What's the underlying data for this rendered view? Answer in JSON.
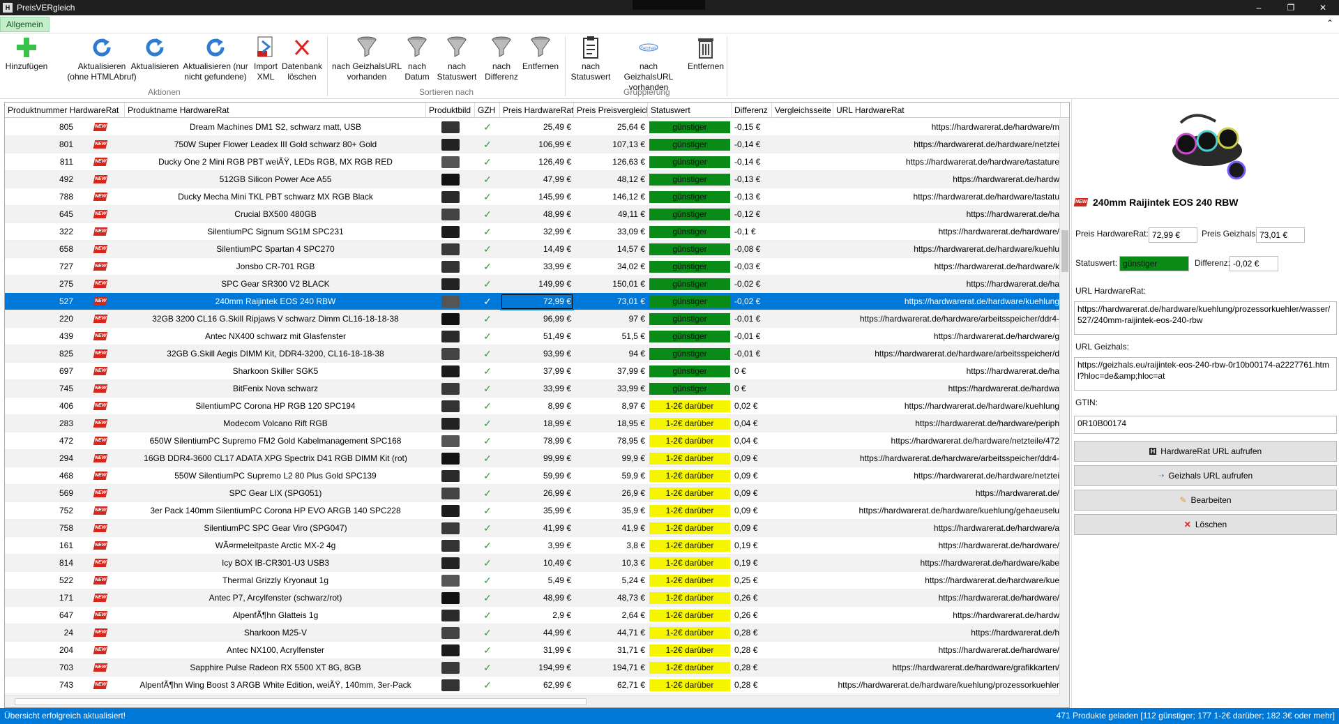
{
  "window": {
    "title": "PreisVERgleich",
    "min": "–",
    "max": "❐",
    "close": "✕"
  },
  "tab": {
    "label": "Allgemein",
    "collapse": "⌃"
  },
  "ribbon": {
    "buttons": [
      {
        "label1": "Hinzufügen",
        "label2": "",
        "icon": "plus-icon"
      },
      {
        "label1": "Aktualisieren",
        "label2": "(ohne HTMLAbruf)",
        "icon": "refresh-icon"
      },
      {
        "label1": "Aktualisieren",
        "label2": "",
        "icon": "refresh-icon"
      },
      {
        "label1": "Aktualisieren (nur",
        "label2": "nicht gefundene)",
        "icon": "refresh-icon"
      },
      {
        "label1": "Import",
        "label2": "XML",
        "icon": "import-icon"
      },
      {
        "label1": "Datenbank",
        "label2": "löschen",
        "icon": "delete-icon"
      },
      {
        "label1": "nach GeizhalsURL",
        "label2": "vorhanden",
        "icon": "filter-icon"
      },
      {
        "label1": "nach",
        "label2": "Datum",
        "icon": "filter-icon"
      },
      {
        "label1": "nach",
        "label2": "Statuswert",
        "icon": "filter-icon"
      },
      {
        "label1": "nach",
        "label2": "Differenz",
        "icon": "filter-icon"
      },
      {
        "label1": "Entfernen",
        "label2": "",
        "icon": "filter-icon"
      },
      {
        "label1": "nach",
        "label2": "Statuswert",
        "icon": "clipboard-icon"
      },
      {
        "label1": "nach GeizhalsURL",
        "label2": "vorhanden",
        "icon": "geizhals-icon"
      },
      {
        "label1": "Entfernen",
        "label2": "",
        "icon": "trash-icon"
      }
    ],
    "groups": [
      "Aktionen",
      "Sortieren nach",
      "Gruppierung"
    ]
  },
  "grid": {
    "columns": [
      "Produktnummer HardwareRat",
      "Produktname HardwareRat",
      "Produktbild",
      "GZH",
      "Preis HardwareRat",
      "Preis Preisvergleich",
      "Statuswert",
      "Differenz",
      "Vergleichsseite",
      "URL HardwareRat"
    ],
    "new_badge": "NEW",
    "check": "✓",
    "rows": [
      {
        "id": "805",
        "name": "Dream Machines DM1 S2, schwarz matt, USB",
        "ph": "25,49 €",
        "pv": "25,64 €",
        "st": "günstiger",
        "diff": "-0,15 €",
        "url": "https://hardwarerat.de/hardware/m"
      },
      {
        "id": "801",
        "name": "750W Super Flower Leadex III Gold schwarz 80+ Gold",
        "ph": "106,99 €",
        "pv": "107,13 €",
        "st": "günstiger",
        "diff": "-0,14 €",
        "url": "https://hardwarerat.de/hardware/netztei"
      },
      {
        "id": "811",
        "name": "Ducky One 2 Mini RGB PBT weiÃŸ, LEDs RGB, MX RGB RED",
        "ph": "126,49 €",
        "pv": "126,63 €",
        "st": "günstiger",
        "diff": "-0,14 €",
        "url": "https://hardwarerat.de/hardware/tastature"
      },
      {
        "id": "492",
        "name": "512GB Silicon Power Ace A55",
        "ph": "47,99 €",
        "pv": "48,12 €",
        "st": "günstiger",
        "diff": "-0,13 €",
        "url": "https://hardwarerat.de/hardw"
      },
      {
        "id": "788",
        "name": "Ducky Mecha Mini TKL PBT schwarz MX RGB Black",
        "ph": "145,99 €",
        "pv": "146,12 €",
        "st": "günstiger",
        "diff": "-0,13 €",
        "url": "https://hardwarerat.de/hardware/tastatu"
      },
      {
        "id": "645",
        "name": "Crucial BX500 480GB",
        "ph": "48,99 €",
        "pv": "49,11 €",
        "st": "günstiger",
        "diff": "-0,12 €",
        "url": "https://hardwarerat.de/ha"
      },
      {
        "id": "322",
        "name": "SilentiumPC Signum SG1M SPC231",
        "ph": "32,99 €",
        "pv": "33,09 €",
        "st": "günstiger",
        "diff": "-0,1 €",
        "url": "https://hardwarerat.de/hardware/"
      },
      {
        "id": "658",
        "name": "SilentiumPC Spartan 4 SPC270",
        "ph": "14,49 €",
        "pv": "14,57 €",
        "st": "günstiger",
        "diff": "-0,08 €",
        "url": "https://hardwarerat.de/hardware/kuehlu"
      },
      {
        "id": "727",
        "name": "Jonsbo CR-701 RGB",
        "ph": "33,99 €",
        "pv": "34,02 €",
        "st": "günstiger",
        "diff": "-0,03 €",
        "url": "https://hardwarerat.de/hardware/k"
      },
      {
        "id": "275",
        "name": "SPC Gear SR300 V2 BLACK",
        "ph": "149,99 €",
        "pv": "150,01 €",
        "st": "günstiger",
        "diff": "-0,02 €",
        "url": "https://hardwarerat.de/ha"
      },
      {
        "id": "527",
        "name": "240mm Raijintek EOS 240 RBW",
        "ph": "72,99 €",
        "pv": "73,01 €",
        "st": "günstiger",
        "diff": "-0,02 €",
        "url": "https://hardwarerat.de/hardware/kuehlung",
        "sel": true
      },
      {
        "id": "220",
        "name": "32GB 3200 CL16 G.Skill Ripjaws V schwarz Dimm CL16-18-18-38",
        "ph": "96,99 €",
        "pv": "97 €",
        "st": "günstiger",
        "diff": "-0,01 €",
        "url": "https://hardwarerat.de/hardware/arbeitsspeicher/ddr4-"
      },
      {
        "id": "439",
        "name": "Antec NX400 schwarz mit Glasfenster",
        "ph": "51,49 €",
        "pv": "51,5 €",
        "st": "günstiger",
        "diff": "-0,01 €",
        "url": "https://hardwarerat.de/hardware/g"
      },
      {
        "id": "825",
        "name": "32GB G.Skill Aegis DIMM Kit, DDR4-3200, CL16-18-18-38",
        "ph": "93,99 €",
        "pv": "94 €",
        "st": "günstiger",
        "diff": "-0,01 €",
        "url": "https://hardwarerat.de/hardware/arbeitsspeicher/d"
      },
      {
        "id": "697",
        "name": "Sharkoon Skiller SGK5",
        "ph": "37,99 €",
        "pv": "37,99 €",
        "st": "günstiger",
        "diff": "0 €",
        "url": "https://hardwarerat.de/ha"
      },
      {
        "id": "745",
        "name": "BitFenix Nova schwarz",
        "ph": "33,99 €",
        "pv": "33,99 €",
        "st": "günstiger",
        "diff": "0 €",
        "url": "https://hardwarerat.de/hardwa"
      },
      {
        "id": "406",
        "name": "SilentiumPC Corona HP RGB 120 SPC194",
        "ph": "8,99 €",
        "pv": "8,97 €",
        "st": "1-2€ darüber",
        "diff": "0,02 €",
        "url": "https://hardwarerat.de/hardware/kuehlung"
      },
      {
        "id": "283",
        "name": "Modecom Volcano Rift RGB",
        "ph": "18,99 €",
        "pv": "18,95 €",
        "st": "1-2€ darüber",
        "diff": "0,04 €",
        "url": "https://hardwarerat.de/hardware/periph"
      },
      {
        "id": "472",
        "name": "650W SilentiumPC Supremo FM2 Gold Kabelmanagement SPC168",
        "ph": "78,99 €",
        "pv": "78,95 €",
        "st": "1-2€ darüber",
        "diff": "0,04 €",
        "url": "https://hardwarerat.de/hardware/netzteile/472"
      },
      {
        "id": "294",
        "name": "16GB DDR4-3600 CL17 ADATA XPG Spectrix D41 RGB DIMM Kit (rot)",
        "ph": "99,99 €",
        "pv": "99,9 €",
        "st": "1-2€ darüber",
        "diff": "0,09 €",
        "url": "https://hardwarerat.de/hardware/arbeitsspeicher/ddr4-"
      },
      {
        "id": "468",
        "name": "550W SilentiumPC Supremo L2 80 Plus Gold SPC139",
        "ph": "59,99 €",
        "pv": "59,9 €",
        "st": "1-2€ darüber",
        "diff": "0,09 €",
        "url": "https://hardwarerat.de/hardware/netztei"
      },
      {
        "id": "569",
        "name": "SPC Gear LIX (SPG051)",
        "ph": "26,99 €",
        "pv": "26,9 €",
        "st": "1-2€ darüber",
        "diff": "0,09 €",
        "url": "https://hardwarerat.de/"
      },
      {
        "id": "752",
        "name": "3er Pack 140mm SilentiumPC Corona HP EVO ARGB 140 SPC228",
        "ph": "35,99 €",
        "pv": "35,9 €",
        "st": "1-2€ darüber",
        "diff": "0,09 €",
        "url": "https://hardwarerat.de/hardware/kuehlung/gehaeuselu"
      },
      {
        "id": "758",
        "name": "SilentiumPC SPC Gear Viro (SPG047)",
        "ph": "41,99 €",
        "pv": "41,9 €",
        "st": "1-2€ darüber",
        "diff": "0,09 €",
        "url": "https://hardwarerat.de/hardware/a"
      },
      {
        "id": "161",
        "name": "WÃ¤rmeleitpaste Arctic MX-2 4g",
        "ph": "3,99 €",
        "pv": "3,8 €",
        "st": "1-2€ darüber",
        "diff": "0,19 €",
        "url": "https://hardwarerat.de/hardware/"
      },
      {
        "id": "814",
        "name": "Icy BOX IB-CR301-U3 USB3",
        "ph": "10,49 €",
        "pv": "10,3 €",
        "st": "1-2€ darüber",
        "diff": "0,19 €",
        "url": "https://hardwarerat.de/hardware/kabe"
      },
      {
        "id": "522",
        "name": "Thermal Grizzly Kryonaut 1g",
        "ph": "5,49 €",
        "pv": "5,24 €",
        "st": "1-2€ darüber",
        "diff": "0,25 €",
        "url": "https://hardwarerat.de/hardware/kue"
      },
      {
        "id": "171",
        "name": "Antec P7, Arcylfenster (schwarz/rot)",
        "ph": "48,99 €",
        "pv": "48,73 €",
        "st": "1-2€ darüber",
        "diff": "0,26 €",
        "url": "https://hardwarerat.de/hardware/"
      },
      {
        "id": "647",
        "name": "AlpenfÃ¶hn Glatteis 1g",
        "ph": "2,9 €",
        "pv": "2,64 €",
        "st": "1-2€ darüber",
        "diff": "0,26 €",
        "url": "https://hardwarerat.de/hardw"
      },
      {
        "id": "24",
        "name": "Sharkoon M25-V",
        "ph": "44,99 €",
        "pv": "44,71 €",
        "st": "1-2€ darüber",
        "diff": "0,28 €",
        "url": "https://hardwarerat.de/h"
      },
      {
        "id": "204",
        "name": "Antec NX100, Acrylfenster",
        "ph": "31,99 €",
        "pv": "31,71 €",
        "st": "1-2€ darüber",
        "diff": "0,28 €",
        "url": "https://hardwarerat.de/hardware/"
      },
      {
        "id": "703",
        "name": "Sapphire Pulse Radeon RX 5500 XT 8G, 8GB",
        "ph": "194,99 €",
        "pv": "194,71 €",
        "st": "1-2€ darüber",
        "diff": "0,28 €",
        "url": "https://hardwarerat.de/hardware/grafikkarten/"
      },
      {
        "id": "743",
        "name": "AlpenfÃ¶hn Wing Boost 3 ARGB White Edition, weiÃŸ, 140mm, 3er-Pack",
        "ph": "62,99 €",
        "pv": "62,71 €",
        "st": "1-2€ darüber",
        "diff": "0,28 €",
        "url": "https://hardwarerat.de/hardware/kuehlung/prozessorkuehler"
      }
    ]
  },
  "status_colors": {
    "günstiger": "#0a8a17",
    "1-2€ darüber": "#f5f500"
  },
  "detail": {
    "title": "240mm Raijintek EOS 240 RBW",
    "preis_hr_label": "Preis HardwareRat:",
    "preis_hr": "72,99 €",
    "preis_gz_label": "Preis Geizhals:",
    "preis_gz": "73,01 €",
    "status_label": "Statuswert:",
    "status": "günstiger",
    "diff_label": "Differenz:",
    "diff": "-0,02 €",
    "url_hr_label": "URL HardwareRat:",
    "url_hr": "https://hardwarerat.de/hardware/kuehlung/prozessorkuehler/wasser/527/240mm-raijintek-eos-240-rbw",
    "url_gz_label": "URL Geizhals:",
    "url_gz": "https://geizhals.eu/raijintek-eos-240-rbw-0r10b00174-a2227761.html?hloc=de&amp;hloc=at",
    "gtin_label": "GTIN:",
    "gtin": "0R10B00174",
    "btn_hr": "HardwareRat URL aufrufen",
    "btn_gz": "Geizhals URL aufrufen",
    "btn_edit": "Bearbeiten",
    "btn_delete": "Löschen"
  },
  "statusbar": {
    "left": "Übersicht erfolgreich aktualisiert!",
    "right": "471 Produkte geladen [112 günstiger; 177 1-2€ darüber; 182 3€ oder mehr]"
  }
}
